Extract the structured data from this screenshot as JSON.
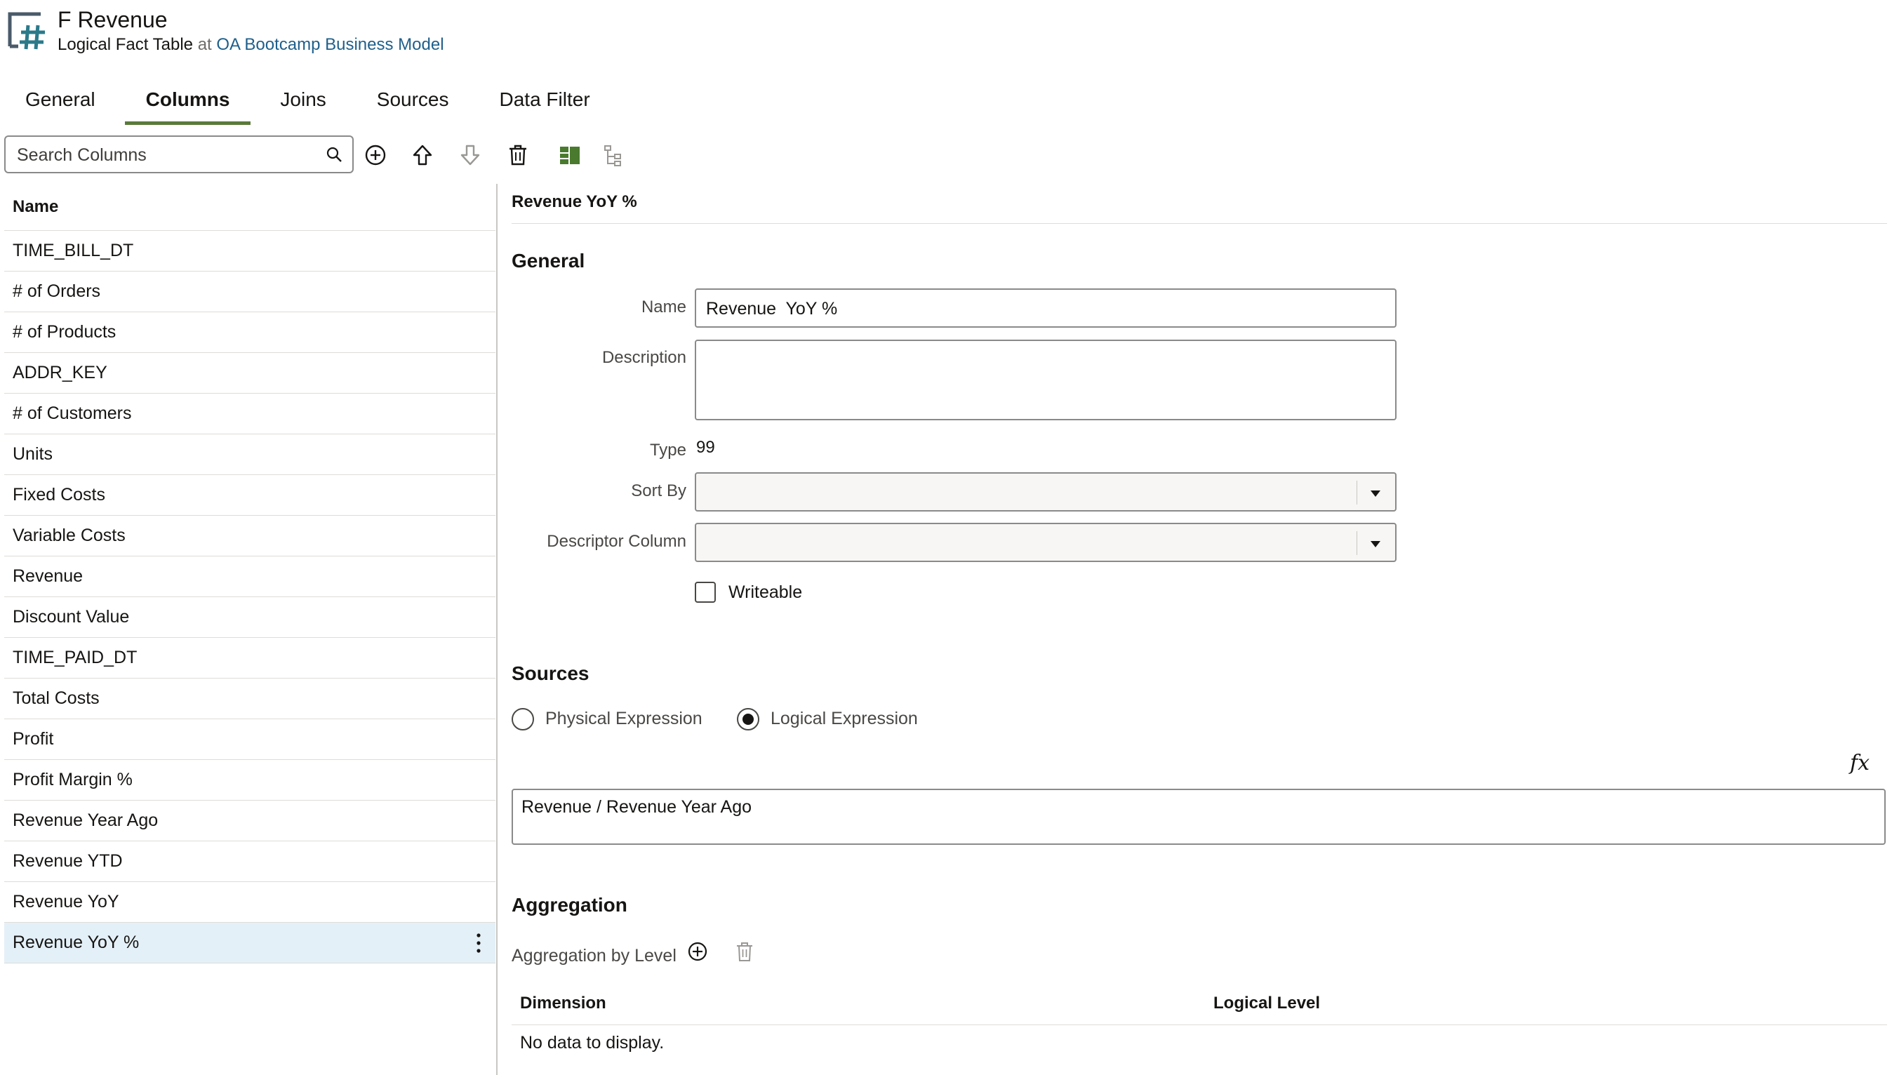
{
  "header": {
    "title": "F Revenue",
    "subtitle_type": "Logical Fact Table",
    "subtitle_at": "at",
    "subtitle_link": "OA Bootcamp Business Model"
  },
  "tabs": [
    {
      "label": "General",
      "active": false
    },
    {
      "label": "Columns",
      "active": true
    },
    {
      "label": "Joins",
      "active": false
    },
    {
      "label": "Sources",
      "active": false
    },
    {
      "label": "Data Filter",
      "active": false
    }
  ],
  "toolbar": {
    "search_placeholder": "Search Columns",
    "icons": [
      "add-icon",
      "move-up-icon",
      "move-down-icon",
      "delete-icon",
      "layout-icon",
      "hierarchy-icon"
    ]
  },
  "columns_list": {
    "header": "Name",
    "items": [
      "TIME_BILL_DT",
      "# of Orders",
      "# of Products",
      "ADDR_KEY",
      "# of Customers",
      "Units",
      "Fixed Costs",
      "Variable Costs",
      "Revenue",
      "Discount Value",
      "TIME_PAID_DT",
      "Total Costs",
      "Profit",
      "Profit Margin %",
      "Revenue Year Ago",
      "Revenue YTD",
      "Revenue YoY",
      "Revenue YoY %"
    ],
    "selected": "Revenue YoY %"
  },
  "detail": {
    "title": "Revenue YoY %",
    "general": {
      "heading": "General",
      "name_label": "Name",
      "name_value": "Revenue  YoY %",
      "description_label": "Description",
      "description_value": "",
      "type_label": "Type",
      "type_value": "99",
      "sort_by_label": "Sort By",
      "sort_by_value": "",
      "descriptor_label": "Descriptor Column",
      "descriptor_value": "",
      "writeable_label": "Writeable",
      "writeable_checked": false
    },
    "sources": {
      "heading": "Sources",
      "physical_label": "Physical Expression",
      "logical_label": "Logical Expression",
      "selected": "logical",
      "fx_label": "fx",
      "expression": "Revenue / Revenue Year Ago"
    },
    "aggregation": {
      "heading": "Aggregation",
      "by_level_label": "Aggregation by Level",
      "col_dimension": "Dimension",
      "col_level": "Logical Level",
      "empty_text": "No data to display."
    }
  },
  "colors": {
    "accent_tab": "#5a7a3a",
    "link": "#1f5f8b",
    "selected_row": "#e4f0f8",
    "layout_icon": "#4a7a2e"
  }
}
